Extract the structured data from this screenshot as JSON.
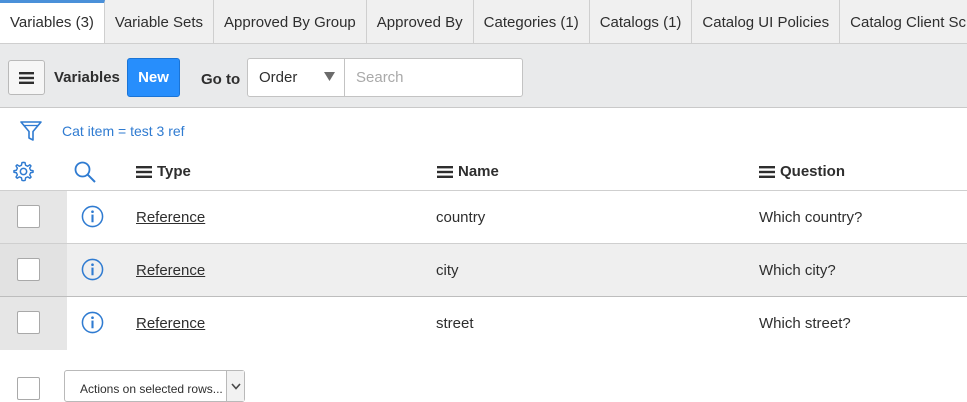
{
  "tabs": [
    {
      "label": "Variables (3)",
      "active": true
    },
    {
      "label": "Variable Sets"
    },
    {
      "label": "Approved By Group"
    },
    {
      "label": "Approved By"
    },
    {
      "label": "Categories (1)"
    },
    {
      "label": "Catalogs (1)"
    },
    {
      "label": "Catalog UI Policies"
    },
    {
      "label": "Catalog Client Scripts"
    }
  ],
  "toolbar": {
    "menu_icon": "hamburger-menu-icon",
    "title": "Variables",
    "new_label": "New",
    "goto_label": "Go to",
    "goto_selected": "Order",
    "search_placeholder": "Search"
  },
  "filter": {
    "icon": "funnel-icon",
    "text": "Cat item = test 3 ref"
  },
  "table": {
    "columns": [
      "Type",
      "Name",
      "Question"
    ],
    "rows": [
      {
        "type": "Reference",
        "name": "country",
        "question": "Which country?"
      },
      {
        "type": "Reference",
        "name": "city",
        "question": "Which city?"
      },
      {
        "type": "Reference",
        "name": "street",
        "question": "Which street?"
      }
    ]
  },
  "footer": {
    "actions_label": "Actions on selected rows..."
  },
  "colors": {
    "accent": "#278efc",
    "link": "#2f7bd1",
    "tab_active_border": "#4a90d9"
  }
}
